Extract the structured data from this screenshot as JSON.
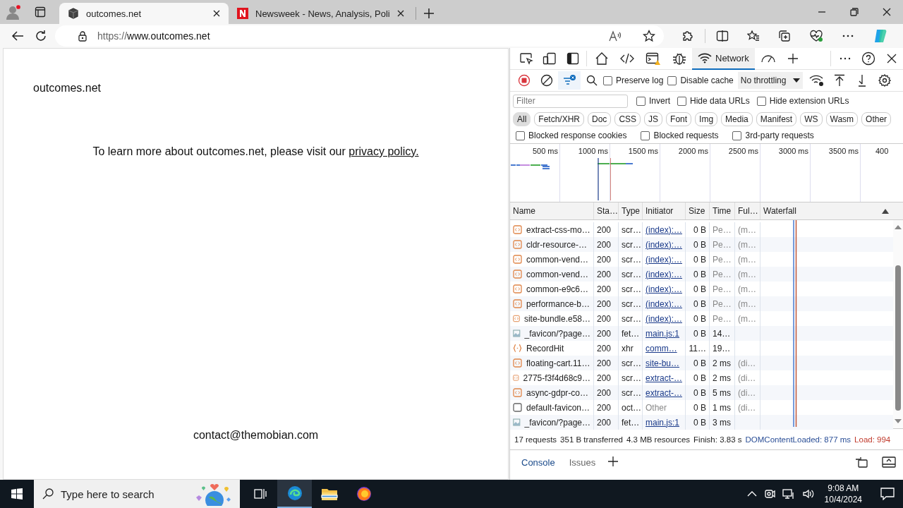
{
  "browser": {
    "tabs": [
      {
        "kind": "site",
        "title": "outcomes.net",
        "selected": true
      },
      {
        "kind": "news",
        "title": "Newsweek - News, Analysis, Poli",
        "selected": false
      }
    ],
    "address": {
      "scheme": "https://",
      "host": "www.outcomes.net"
    }
  },
  "page": {
    "site_name": "outcomes.net",
    "notice": "To learn more about outcomes.net, please visit our ",
    "notice_link": "privacy policy.",
    "contact": "contact@themobian.com"
  },
  "devtools": {
    "panels": [
      {
        "kind": "welcome",
        "selected": false
      },
      {
        "kind": "elements",
        "selected": false
      },
      {
        "kind": "console",
        "selected": false
      },
      {
        "kind": "sources",
        "selected": false
      },
      {
        "kind": "network",
        "label": "Network",
        "selected": true
      },
      {
        "kind": "performance",
        "selected": false
      }
    ],
    "recording": true,
    "options": [
      {
        "label": "Preserve log",
        "checked": false
      },
      {
        "label": "Disable cache",
        "checked": false
      }
    ],
    "throttling": "No throttling",
    "filter": {
      "placeholder": "Filter"
    },
    "filter_options": [
      {
        "label": "Invert",
        "checked": false
      },
      {
        "label": "Hide data URLs",
        "checked": false
      },
      {
        "label": "Hide extension URLs",
        "checked": false
      }
    ],
    "types": [
      {
        "label": "All",
        "selected": true
      },
      {
        "label": "Fetch/XHR",
        "selected": false
      },
      {
        "label": "Doc",
        "selected": false
      },
      {
        "label": "CSS",
        "selected": false
      },
      {
        "label": "JS",
        "selected": false
      },
      {
        "label": "Font",
        "selected": false
      },
      {
        "label": "Img",
        "selected": false
      },
      {
        "label": "Media",
        "selected": false
      },
      {
        "label": "Manifest",
        "selected": false
      },
      {
        "label": "WS",
        "selected": false
      },
      {
        "label": "Wasm",
        "selected": false
      },
      {
        "label": "Other",
        "selected": false
      }
    ],
    "block_options": [
      {
        "label": "Blocked response cookies",
        "checked": false
      },
      {
        "label": "Blocked requests",
        "checked": false
      },
      {
        "label": "3rd-party requests",
        "checked": false
      }
    ],
    "overview_ticks": [
      "500 ms",
      "1000 ms",
      "1500 ms",
      "2000 ms",
      "2500 ms",
      "3000 ms",
      "3500 ms",
      "400"
    ],
    "columns": [
      "Name",
      "Sta…",
      "Type",
      "Initiator",
      "Size",
      "Time",
      "Ful…",
      "Waterfall"
    ],
    "rows": [
      {
        "kind": "script",
        "name": "extract-css-mo…",
        "status": "200",
        "type": "scr…",
        "initiator": "(index):…",
        "link": true,
        "size": "0 B",
        "time": "Pe…",
        "fulfilled": "(m…"
      },
      {
        "kind": "script",
        "name": "cldr-resource-…",
        "status": "200",
        "type": "scr…",
        "initiator": "(index):…",
        "link": true,
        "size": "0 B",
        "time": "Pe…",
        "fulfilled": "(m…"
      },
      {
        "kind": "script",
        "name": "common-vend…",
        "status": "200",
        "type": "scr…",
        "initiator": "(index):…",
        "link": true,
        "size": "0 B",
        "time": "Pe…",
        "fulfilled": "(m…"
      },
      {
        "kind": "script",
        "name": "common-vend…",
        "status": "200",
        "type": "scr…",
        "initiator": "(index):…",
        "link": true,
        "size": "0 B",
        "time": "Pe…",
        "fulfilled": "(m…"
      },
      {
        "kind": "script",
        "name": "common-e9c6…",
        "status": "200",
        "type": "scr…",
        "initiator": "(index):…",
        "link": true,
        "size": "0 B",
        "time": "Pe…",
        "fulfilled": "(m…"
      },
      {
        "kind": "script",
        "name": "performance-b…",
        "status": "200",
        "type": "scr…",
        "initiator": "(index):…",
        "link": true,
        "size": "0 B",
        "time": "Pe…",
        "fulfilled": "(m…"
      },
      {
        "kind": "script",
        "name": "site-bundle.e58…",
        "status": "200",
        "type": "scr…",
        "initiator": "(index):…",
        "link": true,
        "size": "0 B",
        "time": "Pe…",
        "fulfilled": "(m…"
      },
      {
        "kind": "image",
        "name": "_favicon/?page…",
        "status": "200",
        "type": "fet…",
        "initiator": "main.js:1",
        "link": true,
        "size": "0 B",
        "time": "14…"
      },
      {
        "kind": "xhr",
        "name": "RecordHit",
        "status": "200",
        "type": "xhr",
        "initiator": "comm…",
        "link": true,
        "size": "11…",
        "time": "19…"
      },
      {
        "kind": "script",
        "name": "floating-cart.11…",
        "status": "200",
        "type": "scr…",
        "initiator": "site-bu…",
        "link": true,
        "size": "0 B",
        "time": "2 ms",
        "fulfilled": "(di…"
      },
      {
        "kind": "script",
        "name": "2775-f3f4d68c9…",
        "status": "200",
        "type": "scr…",
        "initiator": "extract-…",
        "link": true,
        "size": "0 B",
        "time": "2 ms",
        "fulfilled": "(di…"
      },
      {
        "kind": "script",
        "name": "async-gdpr-co…",
        "status": "200",
        "type": "scr…",
        "initiator": "extract-…",
        "link": true,
        "size": "0 B",
        "time": "5 ms",
        "fulfilled": "(di…"
      },
      {
        "kind": "document",
        "name": "default-favicon…",
        "status": "200",
        "type": "oct…",
        "initiator": "Other",
        "link": false,
        "size": "0 B",
        "time": "1 ms",
        "fulfilled": "(di…"
      },
      {
        "kind": "image",
        "name": "_favicon/?page…",
        "status": "200",
        "type": "fet…",
        "initiator": "main.js:1",
        "link": true,
        "size": "0 B",
        "time": "3 ms"
      }
    ],
    "summary": [
      "17 requests",
      "351 B transferred",
      "4.3 MB resources",
      "Finish: 3.83 s"
    ],
    "dom_loaded": "DOMContentLoaded: 877 ms",
    "load": "Load: 994",
    "drawer_tabs": [
      {
        "label": "Console",
        "selected": true
      },
      {
        "label": "Issues",
        "selected": false
      }
    ]
  },
  "taskbar": {
    "search_placeholder": "Type here to search",
    "apps": [
      {
        "kind": "taskview",
        "selected": false
      },
      {
        "kind": "edge",
        "selected": true
      },
      {
        "kind": "explorer",
        "selected": false
      },
      {
        "kind": "firefox",
        "selected": false
      }
    ],
    "time": "9:08 AM",
    "date": "10/4/2024"
  }
}
